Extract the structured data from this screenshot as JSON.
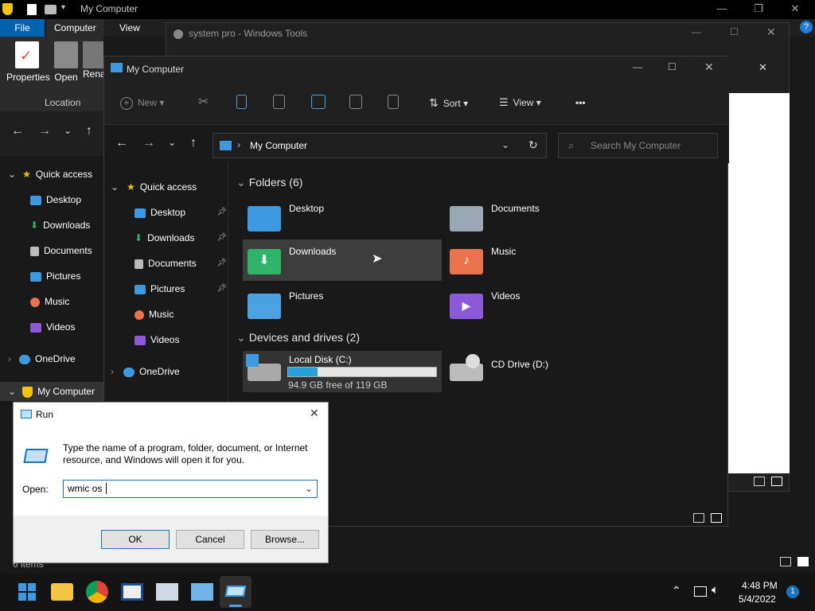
{
  "back_window": {
    "title": "My Computer",
    "tabs": [
      "File",
      "Computer",
      "View"
    ],
    "ribbon_buttons": [
      "Properties",
      "Open",
      "Rena"
    ],
    "ribbon_group": "Location",
    "quick_access": "Quick access",
    "items": [
      "Desktop",
      "Downloads",
      "Documents",
      "Pictures",
      "Music",
      "Videos"
    ],
    "onedrive": "OneDrive",
    "my_computer": "My Computer",
    "status": "6 items"
  },
  "tools_window": {
    "title": "system pro - Windows Tools"
  },
  "main_window": {
    "title": "My Computer",
    "toolbar": {
      "new": "New",
      "sort": "Sort",
      "view": "View",
      "more": "•••"
    },
    "address": "My Computer",
    "search_placeholder": "Search My Computer",
    "nav": {
      "quick_access": "Quick access",
      "items": [
        "Desktop",
        "Downloads",
        "Documents",
        "Pictures",
        "Music",
        "Videos"
      ],
      "onedrive": "OneDrive"
    },
    "folders_header": "Folders (6)",
    "folders": [
      "Desktop",
      "Documents",
      "Downloads",
      "Music",
      "Pictures",
      "Videos"
    ],
    "drives_header": "Devices and drives (2)",
    "drive_c": {
      "name": "Local Disk (C:)",
      "free": "94.9 GB free of 119 GB",
      "used_fraction": 0.2
    },
    "drive_d": {
      "name": "CD Drive (D:)"
    }
  },
  "run_dialog": {
    "title": "Run",
    "description": "Type the name of a program, folder, document, or Internet resource, and Windows will open it for you.",
    "open_label": "Open:",
    "input_value": "wmic os ",
    "ok": "OK",
    "cancel": "Cancel",
    "browse": "Browse..."
  },
  "taskbar": {
    "time": "4:48 PM",
    "date": "5/4/2022",
    "notifications": "1"
  },
  "colors": {
    "accent": "#0078d4",
    "selected": "#3d3d3d",
    "folder": "#4aa3e0"
  }
}
